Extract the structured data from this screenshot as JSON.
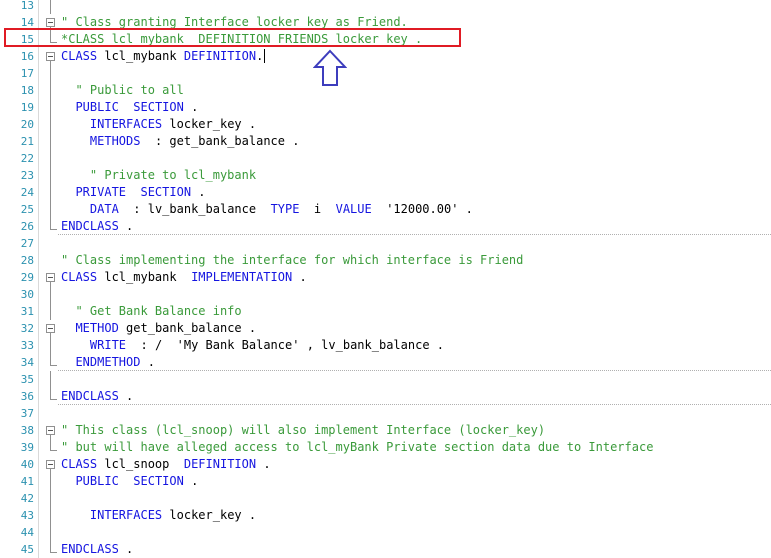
{
  "editor": {
    "lines": [
      {
        "n": "13",
        "text": "",
        "mark": "guide",
        "dotted": false
      },
      {
        "n": "14",
        "text": "\" Class granting Interface locker_key as Friend.",
        "mark": "fold",
        "dotted": false
      },
      {
        "n": "15",
        "text": "*CLASS lcl_mybank  DEFINITION FRIENDS locker_key .",
        "mark": "end",
        "dotted": false
      },
      {
        "n": "16",
        "text": "CLASS lcl_mybank DEFINITION.",
        "mark": "fold",
        "dotted": false,
        "caret": true
      },
      {
        "n": "17",
        "text": "",
        "mark": "guide",
        "dotted": false
      },
      {
        "n": "18",
        "text": "  \" Public to all",
        "mark": "guide",
        "dotted": false
      },
      {
        "n": "19",
        "text": "  PUBLIC  SECTION .",
        "mark": "guide",
        "dotted": false
      },
      {
        "n": "20",
        "text": "    INTERFACES locker_key .",
        "mark": "guide",
        "dotted": false
      },
      {
        "n": "21",
        "text": "    METHODS  : get_bank_balance .",
        "mark": "guide",
        "dotted": false
      },
      {
        "n": "22",
        "text": "",
        "mark": "guide",
        "dotted": false
      },
      {
        "n": "23",
        "text": "    \" Private to lcl_mybank",
        "mark": "guide",
        "dotted": false
      },
      {
        "n": "24",
        "text": "  PRIVATE  SECTION .",
        "mark": "guide",
        "dotted": false
      },
      {
        "n": "25",
        "text": "    DATA  : lv_bank_balance  TYPE  i  VALUE  '12000.00' .",
        "mark": "guide",
        "dotted": false
      },
      {
        "n": "26",
        "text": "ENDCLASS .",
        "mark": "end",
        "dotted": true
      },
      {
        "n": "27",
        "text": "",
        "mark": "none",
        "dotted": false
      },
      {
        "n": "28",
        "text": "\" Class implementing the interface for which interface is Friend",
        "mark": "none",
        "dotted": false
      },
      {
        "n": "29",
        "text": "CLASS lcl_mybank  IMPLEMENTATION .",
        "mark": "fold",
        "dotted": false
      },
      {
        "n": "30",
        "text": "",
        "mark": "guide",
        "dotted": false
      },
      {
        "n": "31",
        "text": "  \" Get Bank Balance info",
        "mark": "guide",
        "dotted": false
      },
      {
        "n": "32",
        "text": "  METHOD get_bank_balance .",
        "mark": "fold",
        "dotted": false
      },
      {
        "n": "33",
        "text": "    WRITE  : /  'My Bank Balance' , lv_bank_balance .",
        "mark": "guide",
        "dotted": false
      },
      {
        "n": "34",
        "text": "  ENDMETHOD .",
        "mark": "end",
        "dotted": true
      },
      {
        "n": "35",
        "text": "",
        "mark": "guide",
        "dotted": false
      },
      {
        "n": "36",
        "text": "ENDCLASS .",
        "mark": "end",
        "dotted": true
      },
      {
        "n": "37",
        "text": "",
        "mark": "none",
        "dotted": false
      },
      {
        "n": "38",
        "text": "\" This class (lcl_snoop) will also implement Interface (locker_key)",
        "mark": "fold",
        "dotted": false
      },
      {
        "n": "39",
        "text": "\" but will have alleged access to lcl_myBank Private section data due to Interface",
        "mark": "end",
        "dotted": false
      },
      {
        "n": "40",
        "text": "CLASS lcl_snoop  DEFINITION .",
        "mark": "fold",
        "dotted": false
      },
      {
        "n": "41",
        "text": "  PUBLIC  SECTION .",
        "mark": "guide",
        "dotted": false
      },
      {
        "n": "42",
        "text": "",
        "mark": "guide",
        "dotted": false
      },
      {
        "n": "43",
        "text": "    INTERFACES locker_key .",
        "mark": "guide",
        "dotted": false
      },
      {
        "n": "44",
        "text": "",
        "mark": "guide",
        "dotted": false
      },
      {
        "n": "45",
        "text": "ENDCLASS .",
        "mark": "end",
        "dotted": false
      }
    ]
  },
  "colors": {
    "comment": "#3a9a3a",
    "keyword": "#1515e0",
    "text": "#000000",
    "line_number": "#2b91af",
    "highlight_box": "#e01b24",
    "arrow": "#3d3dbd"
  },
  "annotations": {
    "highlighted_line": "15",
    "arrow_icon": "up-arrow-icon"
  }
}
